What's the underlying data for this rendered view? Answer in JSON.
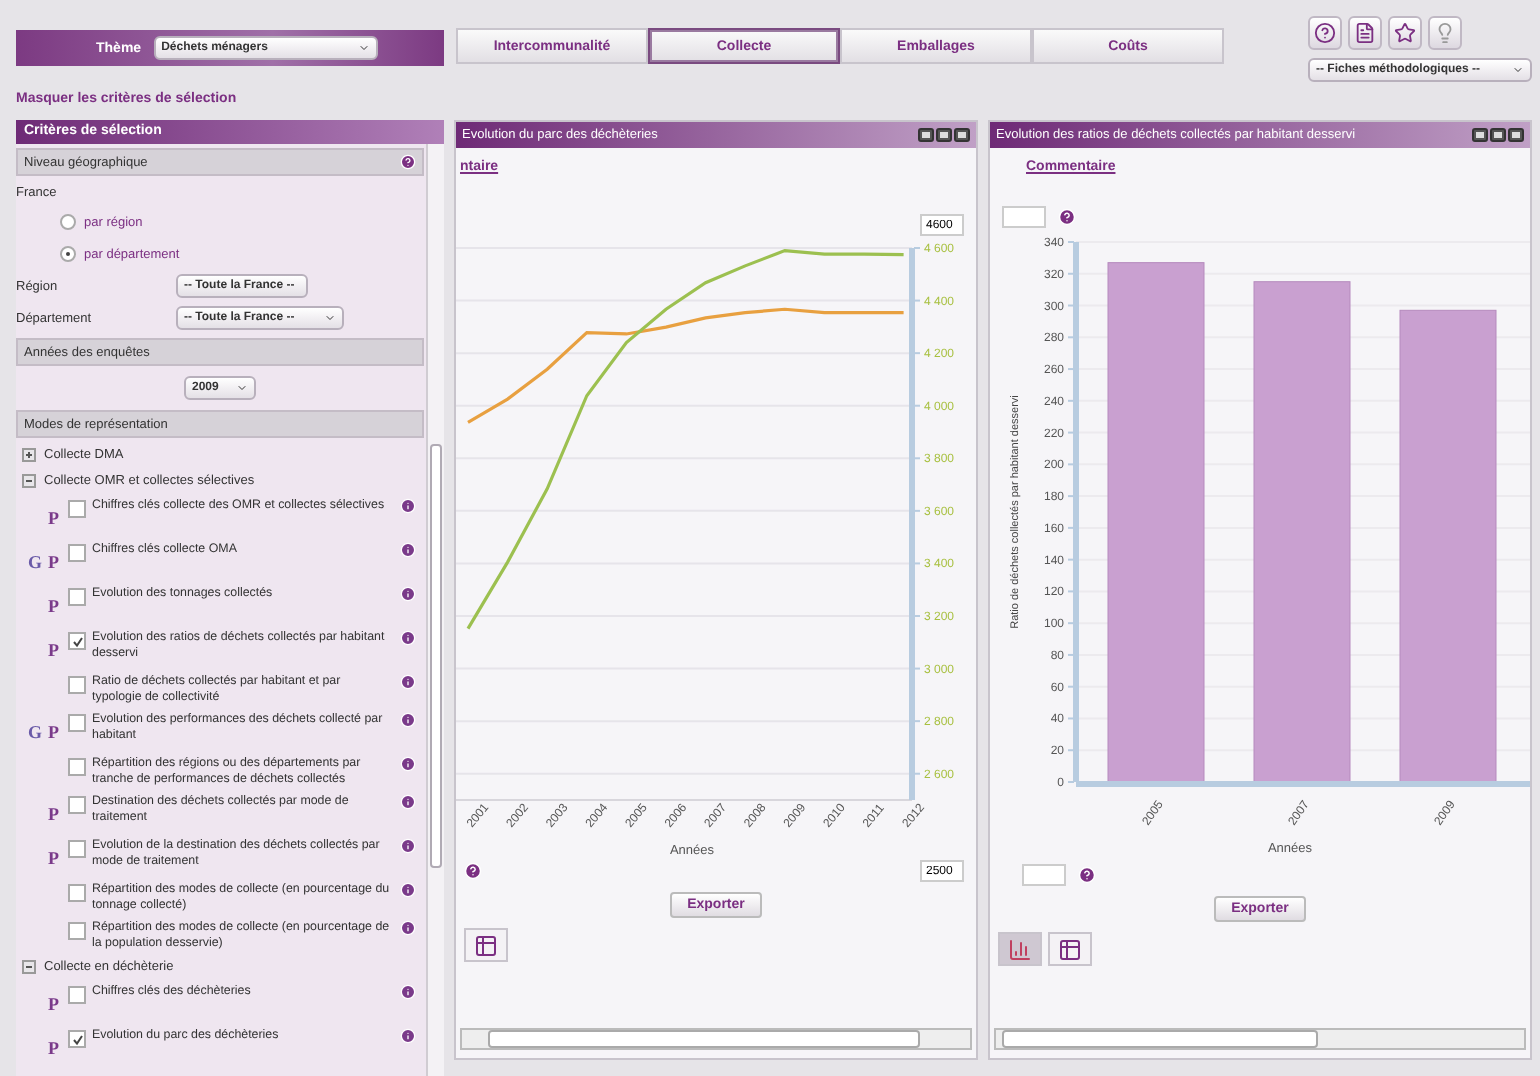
{
  "theme": {
    "label": "Thème",
    "value": "Déchets ménagers"
  },
  "tabs": [
    {
      "label": "Intercommunalité",
      "selected": false
    },
    {
      "label": "Collecte",
      "selected": true
    },
    {
      "label": "Emballages",
      "selected": false
    },
    {
      "label": "Coûts",
      "selected": false
    }
  ],
  "methodology_select": "-- Fiches méthodologiques --",
  "toggle_criteria": "Masquer les critères de sélection",
  "criteria": {
    "title": "Critères de sélection",
    "geo_heading": "Niveau géographique",
    "scope": "France",
    "levels": [
      {
        "label": "par région",
        "selected": false
      },
      {
        "label": "par département",
        "selected": true
      }
    ],
    "filters": [
      {
        "label": "Région",
        "value": "-- Toute la France --"
      },
      {
        "label": "Département",
        "value": "-- Toute la France --"
      }
    ],
    "years_heading": "Années des enquêtes",
    "year": "2009",
    "modes_heading": "Modes de représentation",
    "groups": [
      {
        "label": "Collecte DMA",
        "expanded": false
      },
      {
        "label": "Collecte OMR et collectes sélectives",
        "expanded": true,
        "children": [
          {
            "p": "P",
            "label": "Chiffres clés collecte des OMR et collectes sélectives",
            "checked": false
          },
          {
            "g": "G",
            "p": "P",
            "label": "Chiffres clés collecte OMA",
            "checked": false
          },
          {
            "p": "P",
            "label": "Evolution des tonnages collectés",
            "checked": false
          },
          {
            "p": "P",
            "label": "Evolution des ratios de déchets collectés par habitant desservi",
            "checked": true
          },
          {
            "label": "Ratio de déchets collectés par habitant et par typologie de collectivité",
            "checked": false
          },
          {
            "g": "G",
            "p": "P",
            "label": "Evolution des performances des déchets collecté par habitant",
            "checked": false
          },
          {
            "label": "Répartition des régions ou des départements par tranche de performances de déchets collectés",
            "checked": false
          },
          {
            "p": "P",
            "label": "Destination des déchets collectés par mode de traitement",
            "checked": false
          },
          {
            "p": "P",
            "label": "Evolution de la destination des déchets collectés par mode de traitement",
            "checked": false
          },
          {
            "label": "Répartition des modes de collecte (en pourcentage du tonnage collecté)",
            "checked": false
          },
          {
            "label": "Répartition des modes de collecte (en pourcentage de la population desservie)",
            "checked": false
          }
        ]
      },
      {
        "label": "Collecte en déchèterie",
        "expanded": true,
        "children": [
          {
            "p": "P",
            "label": "Chiffres clés des déchèteries",
            "checked": false
          },
          {
            "p": "P",
            "label": "Evolution du parc des déchèteries",
            "checked": true
          }
        ]
      }
    ]
  },
  "panels": [
    {
      "title": "Evolution du parc des déchèteries",
      "comment_link": "ntaire",
      "max_input": "4600",
      "min_input": "2500",
      "export": "Exporter",
      "views": [
        {
          "kind": "table",
          "selected": false
        }
      ],
      "chart_data": {
        "type": "line",
        "xlabel": "Années",
        "x": [
          2001,
          2002,
          2003,
          2004,
          2005,
          2006,
          2007,
          2008,
          2009,
          2010,
          2011,
          2012
        ],
        "series": [
          {
            "color": "#e8a040",
            "values": [
              3937,
              4025,
              4139,
              4278,
              4273,
              4299,
              4334,
              4354,
              4367,
              4354,
              4354,
              4354
            ]
          },
          {
            "color": "#9cc050",
            "values": [
              3152,
              3405,
              3684,
              4038,
              4240,
              4367,
              4468,
              4532,
              4590,
              4577,
              4577,
              4575
            ]
          }
        ],
        "ylim": [
          2500,
          4600
        ],
        "grid": true,
        "yticks": [
          {
            "value": 2600,
            "label": "2 600"
          },
          {
            "value": 2800,
            "label": "2 800"
          },
          {
            "value": 3000,
            "label": "3 000"
          },
          {
            "value": 3200,
            "label": "3 200"
          },
          {
            "value": 3400,
            "label": "3 400"
          },
          {
            "value": 3600,
            "label": "3 600"
          },
          {
            "value": 3800,
            "label": "3 800"
          },
          {
            "value": 4000,
            "label": "4 000"
          },
          {
            "value": 4200,
            "label": "4 200"
          },
          {
            "value": 4400,
            "label": "4 400"
          },
          {
            "value": 4600,
            "label": "4 600"
          }
        ]
      }
    },
    {
      "title": "Evolution des ratios de déchets collectés par habitant desservi",
      "comment_link": "Commentaire",
      "export": "Exporter",
      "views": [
        {
          "kind": "chart",
          "selected": true
        },
        {
          "kind": "table",
          "selected": false
        }
      ],
      "chart_data": {
        "type": "bar",
        "xlabel": "Années",
        "ylabel": "Ratio de déchets collectés par habitant desservi",
        "categories": [
          "2005",
          "2007",
          "2009"
        ],
        "series": [
          {
            "color": "#c9a0d0",
            "values": [
              327,
              315,
              297
            ]
          }
        ],
        "ylim": [
          0,
          340
        ],
        "grid": true,
        "yticks": [
          0,
          20,
          40,
          60,
          80,
          100,
          120,
          140,
          160,
          180,
          200,
          220,
          240,
          260,
          280,
          300,
          320,
          340
        ]
      }
    }
  ]
}
